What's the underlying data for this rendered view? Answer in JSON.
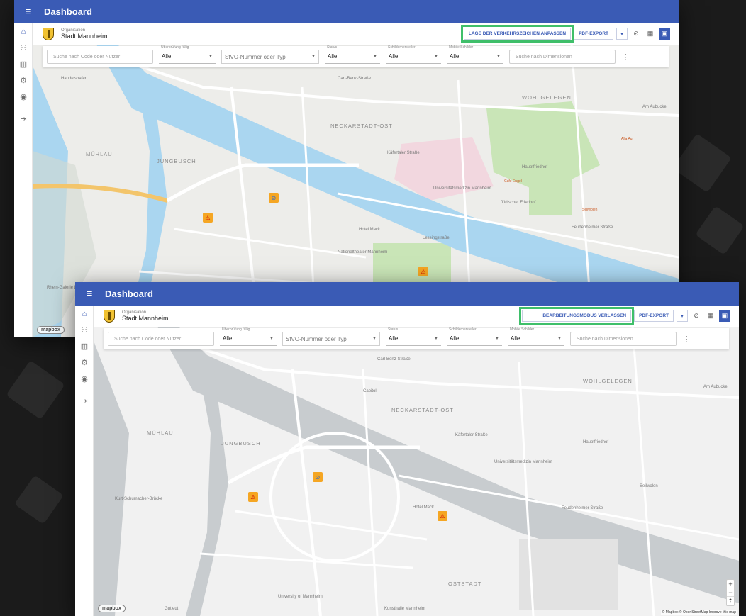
{
  "app": {
    "title": "Dashboard"
  },
  "rail": {
    "items": [
      "home-icon",
      "people-icon",
      "chart-icon",
      "gear-icon",
      "account-icon",
      "logout-icon"
    ]
  },
  "org": {
    "label": "Organisation",
    "name": "Stadt Mannheim"
  },
  "window1": {
    "primary_button": "LAGE DER VERKEHRSZEICHEN ANPASSEN",
    "export_button": "PDF-EXPORT"
  },
  "window2": {
    "primary_button": "BEARBEITUNGSMODUS VERLASSEN",
    "export_button": "PDF-EXPORT"
  },
  "filters": {
    "search_placeholder": "Suche nach Code oder Nutzer",
    "due_label": "Überprüfung fällig",
    "due_value": "Alle",
    "stvo_placeholder": "StVO-Nummer oder Typ",
    "status_label": "Status",
    "status_value": "Alle",
    "maker_label": "Schilderhersteller",
    "maker_value": "Alle",
    "mobile_label": "Mobile Schilder",
    "mobile_value": "Alle",
    "dim_placeholder": "Suche nach Dimensionen"
  },
  "map": {
    "logo": "mapbox",
    "attribution": "© Mapbox © OpenStreetMap Improve this map",
    "labels1": [
      "Handelshafen",
      "MÜHLAU",
      "JUNGBUSCH",
      "NECKARSTADT-OST",
      "WOHLGELEGEN",
      "Cart-Benz-Straße",
      "Käfertaler Straße",
      "Feudenheimer Straße",
      "Hauptfriedhof",
      "Jüdischer Friedhof",
      "Universitätsmedizin Mannheim",
      "Hotel Mack",
      "Lessingstraße",
      "Nationaltheater Mannheim",
      "Rhein-Galerie Ludwigshafen",
      "Am Aubuckel",
      "Alla Au",
      "Cafe Engel",
      "Seilwolen"
    ],
    "labels2": [
      "Carl-Benz-Straße",
      "MÜHLAU",
      "JUNGBUSCH",
      "NECKARSTADT-OST",
      "WOHLGELEGEN",
      "Käfertaler Straße",
      "Feudenheimer Straße",
      "Hauptfriedhof",
      "Universitätsmedizin Mannheim",
      "Hotel Mack",
      "OSTSTADT",
      "Am Aubuckel",
      "Seilwolen",
      "Kunsthalle Mannheim",
      "University of Mannheim",
      "Kurt-Schumacher-Brücke",
      "Gutleut",
      "Capitol"
    ]
  },
  "colors": {
    "accent": "#3a5bb5",
    "highlight": "#3fbf6a",
    "marker": "#f5a623"
  }
}
